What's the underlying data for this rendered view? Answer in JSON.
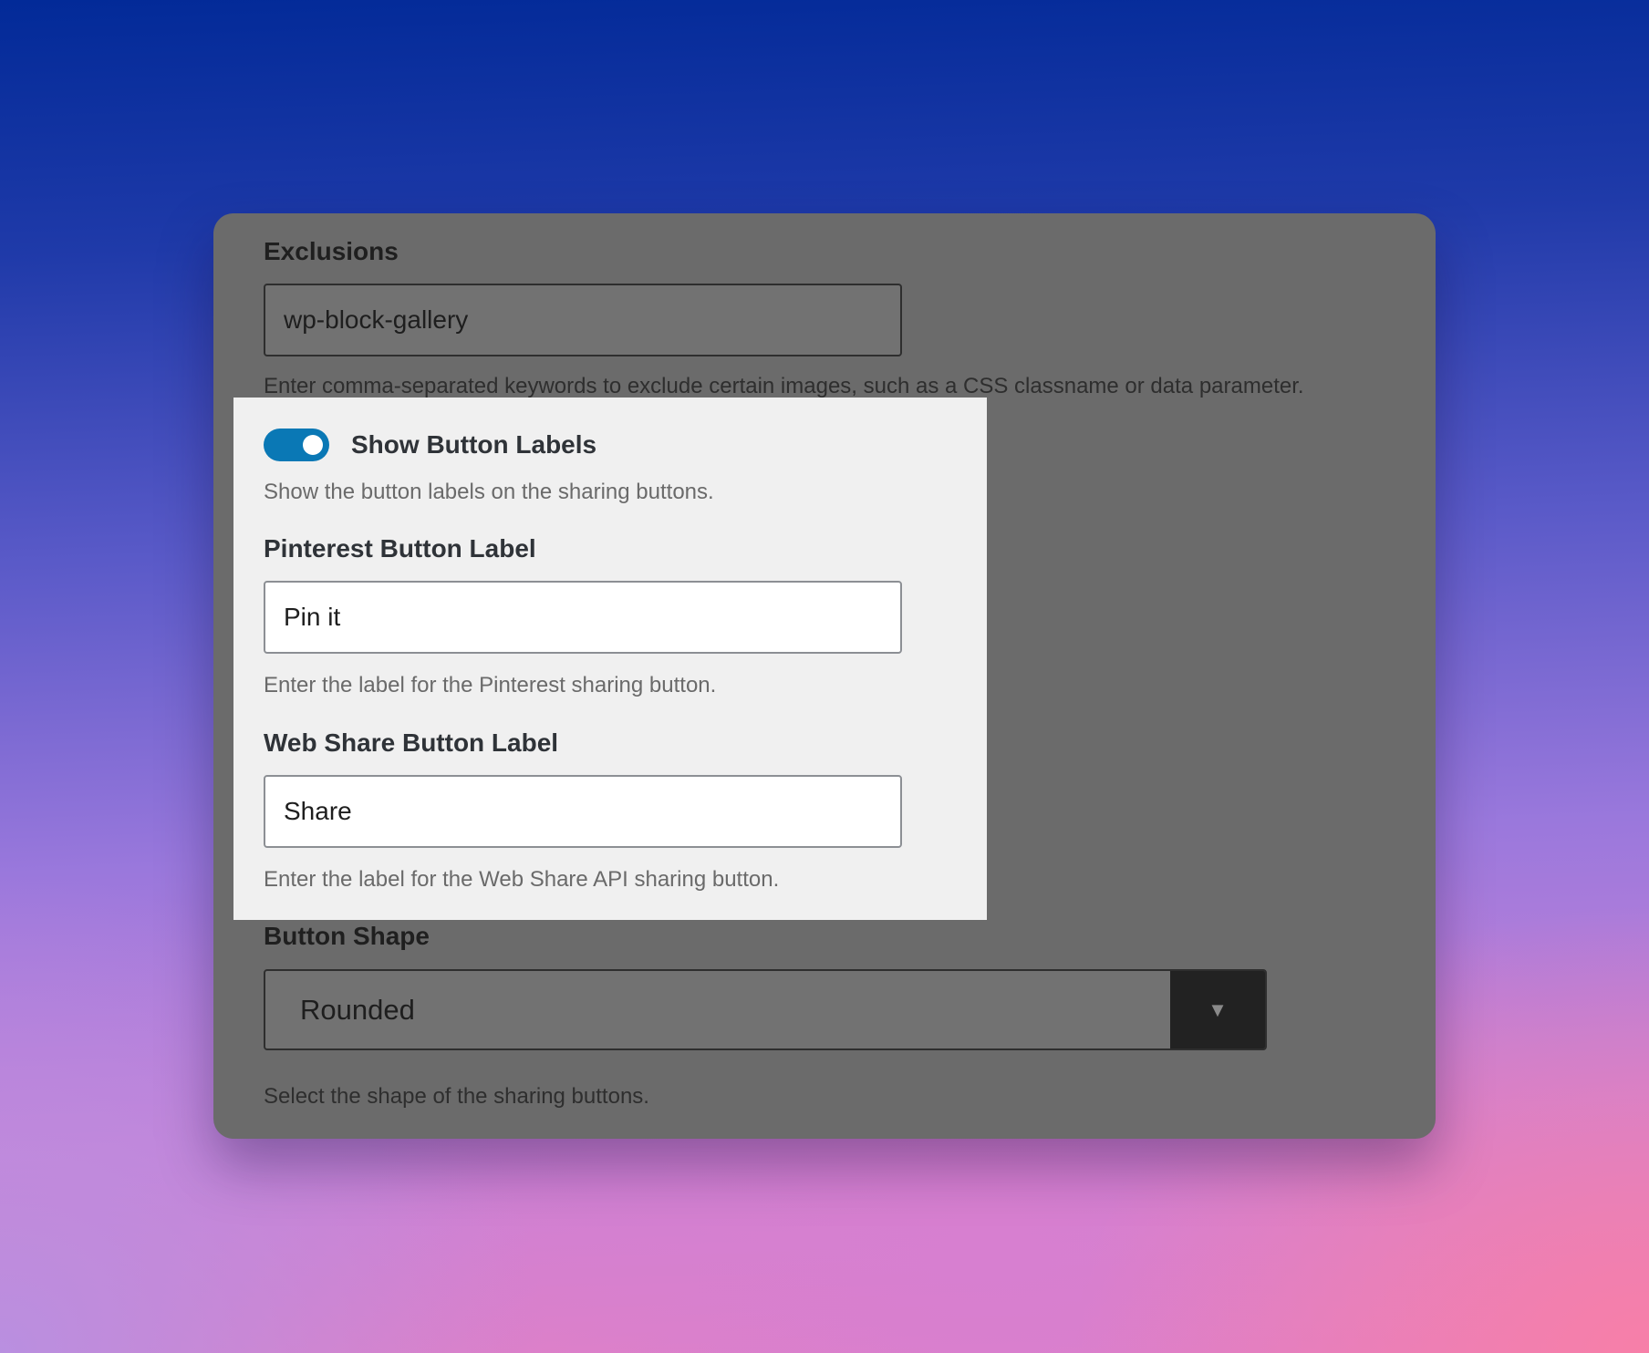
{
  "exclusions": {
    "label": "Exclusions",
    "value": "wp-block-gallery",
    "help": "Enter comma-separated keywords to exclude certain images, such as a CSS classname or data parameter."
  },
  "show_labels": {
    "label": "Show Button Labels",
    "enabled": true,
    "help": "Show the button labels on the sharing buttons."
  },
  "pinterest_label": {
    "label": "Pinterest Button Label",
    "value": "Pin it",
    "help": "Enter the label for the Pinterest sharing button."
  },
  "webshare_label": {
    "label": "Web Share Button Label",
    "value": "Share",
    "help": "Enter the label for the Web Share API sharing button."
  },
  "button_shape": {
    "label": "Button Shape",
    "selected": "Rounded",
    "dropdown_icon": "triangle-down-icon",
    "help": "Select the shape of the sharing buttons."
  },
  "colors": {
    "toggle_on": "#0a78b5",
    "highlight_bg": "#f0f0f0",
    "panel_bg": "#6b6b6b"
  }
}
